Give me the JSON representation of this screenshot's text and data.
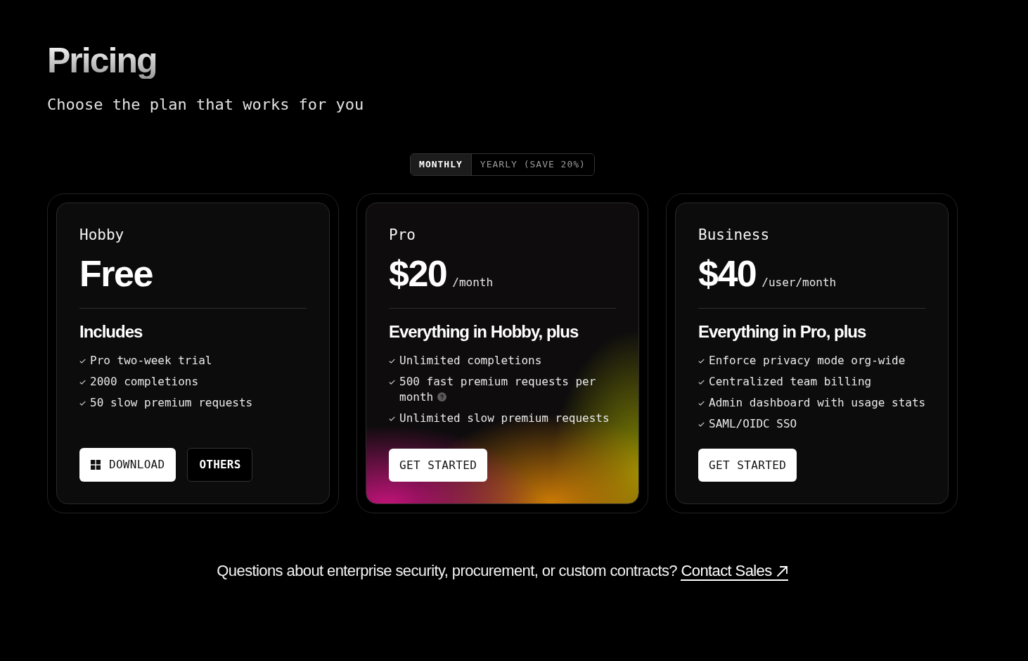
{
  "header": {
    "title": "Pricing",
    "subtitle": "Choose the plan that works for you"
  },
  "billing_toggle": [
    {
      "label": "MONTHLY",
      "selected": true
    },
    {
      "label": "YEARLY (SAVE 20%)",
      "selected": false
    }
  ],
  "plans": [
    {
      "name": "Hobby",
      "price": "Free",
      "highlighted": false,
      "heading": "Includes",
      "features": [
        {
          "text": "Pro two-week trial",
          "help": false
        },
        {
          "text": "2000 completions",
          "help": false
        },
        {
          "text": "50 slow premium requests",
          "help": false
        }
      ],
      "buttons": [
        {
          "label": "DOWNLOAD",
          "kind": "download"
        },
        {
          "label": "OTHERS",
          "kind": "outline"
        }
      ]
    },
    {
      "name": "Pro",
      "price": "$20",
      "period": "/month",
      "highlighted": true,
      "heading": "Everything in Hobby, plus",
      "features": [
        {
          "text": "Unlimited completions",
          "help": false
        },
        {
          "text": "500 fast premium requests per month",
          "help": true
        },
        {
          "text": "Unlimited slow premium requests",
          "help": false
        }
      ],
      "buttons": [
        {
          "label": "GET STARTED",
          "kind": "primary"
        }
      ]
    },
    {
      "name": "Business",
      "price": "$40",
      "period": "/user/month",
      "highlighted": false,
      "heading": "Everything in Pro, plus",
      "features": [
        {
          "text": "Enforce privacy mode org-wide",
          "help": false
        },
        {
          "text": "Centralized team billing",
          "help": false
        },
        {
          "text": "Admin dashboard with usage stats",
          "help": false
        },
        {
          "text": "SAML/OIDC SSO",
          "help": false
        }
      ],
      "buttons": [
        {
          "label": "GET STARTED",
          "kind": "primary"
        }
      ]
    }
  ],
  "footer": {
    "text": "Questions about enterprise security, procurement, or custom contracts?",
    "link": "Contact Sales"
  }
}
